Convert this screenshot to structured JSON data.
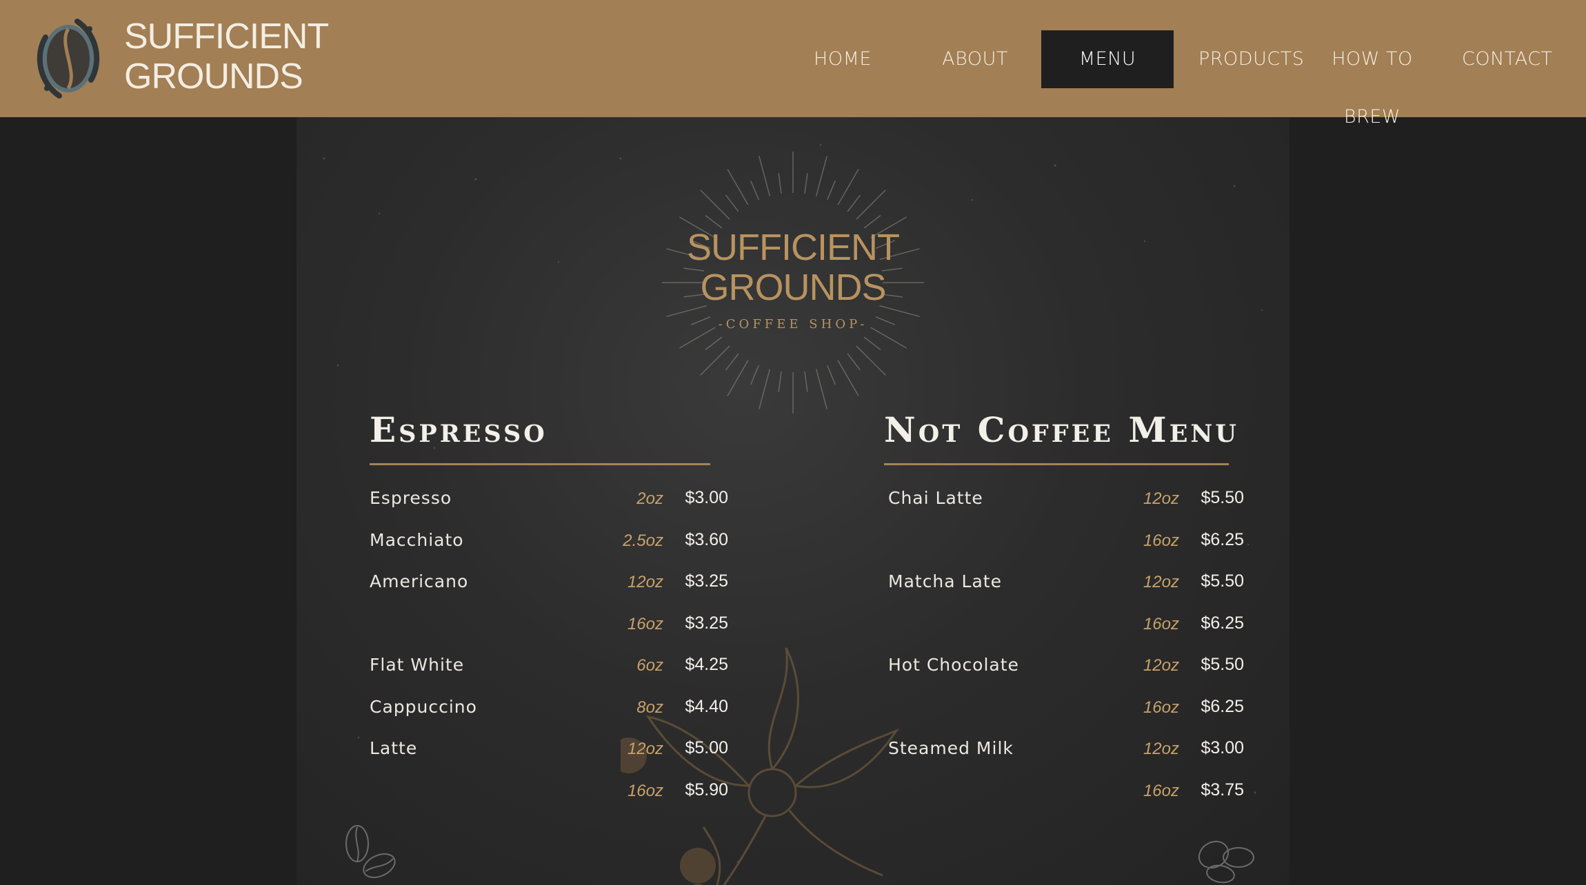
{
  "brand": {
    "line1": "SUFFICIENT",
    "line2": "GROUNDS"
  },
  "nav": [
    {
      "label": "HOME",
      "active": false
    },
    {
      "label": "ABOUT",
      "active": false
    },
    {
      "label": "MENU",
      "active": true
    },
    {
      "label": "PRODUCTS",
      "active": false
    },
    {
      "label": "HOW TO BREW",
      "active": false
    },
    {
      "label": "CONTACT",
      "active": false
    }
  ],
  "board_logo": {
    "line1": "SUFFICIENT",
    "line2": "GROUNDS",
    "sub": "-COFFEE SHOP-"
  },
  "espresso": {
    "title": "Espresso",
    "rows": [
      {
        "item": "Espresso",
        "size": "2oz",
        "price": "$3.00"
      },
      {
        "item": "Macchiato",
        "size": "2.5oz",
        "price": "$3.60"
      },
      {
        "item": "Americano",
        "size": "12oz",
        "price": "$3.25"
      },
      {
        "item": "",
        "size": "16oz",
        "price": "$3.25"
      },
      {
        "item": "Flat White",
        "size": "6oz",
        "price": "$4.25"
      },
      {
        "item": "Cappuccino",
        "size": "8oz",
        "price": "$4.40"
      },
      {
        "item": "Latte",
        "size": "12oz",
        "price": "$5.00"
      },
      {
        "item": "",
        "size": "16oz",
        "price": "$5.90"
      }
    ]
  },
  "not_coffee": {
    "title": "Not Coffee Menu",
    "rows": [
      {
        "item": "Chai Latte",
        "size": "12oz",
        "price": "$5.50"
      },
      {
        "item": "",
        "size": "16oz",
        "price": "$6.25"
      },
      {
        "item": "Matcha Late",
        "size": "12oz",
        "price": "$5.50"
      },
      {
        "item": "",
        "size": "16oz",
        "price": "$6.25"
      },
      {
        "item": "Hot Chocolate",
        "size": "12oz",
        "price": "$5.50"
      },
      {
        "item": "",
        "size": "16oz",
        "price": "$6.25"
      },
      {
        "item": "Steamed Milk",
        "size": "12oz",
        "price": "$3.00"
      },
      {
        "item": "",
        "size": "16oz",
        "price": "$3.75"
      }
    ]
  },
  "colors": {
    "header": "#a27f54",
    "accent": "#b8935f",
    "page_bg": "#1f1f1f",
    "board": "#2c2c2c"
  }
}
